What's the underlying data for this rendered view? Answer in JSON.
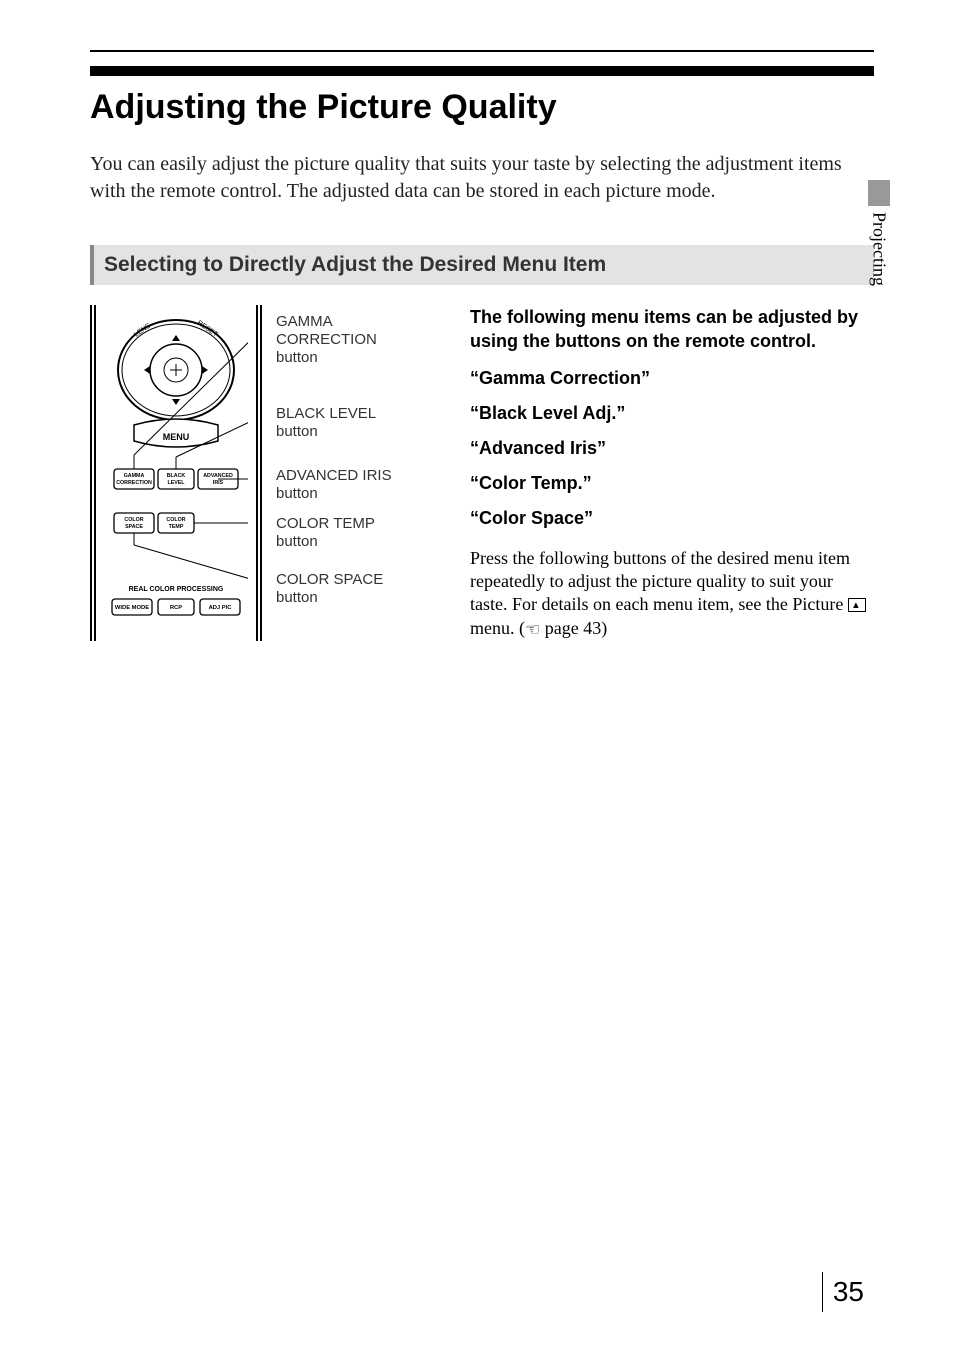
{
  "section_tab": "Projecting",
  "page_number": "35",
  "title": "Adjusting the Picture Quality",
  "intro": "You can easily adjust the picture quality that suits your taste by selecting the adjustment items with the remote control. The adjusted data can be stored in each picture mode.",
  "section_heading": "Selecting to Directly Adjust the Desired Menu Item",
  "diagram": {
    "menu_label": "MENU",
    "buttons": {
      "gamma_correction": "GAMMA\nCORRECTION",
      "black_level": "BLACK\nLEVEL",
      "advanced_iris": "ADVANCED\nIRIS",
      "color_space": "COLOR\nSPACE",
      "color_temp": "COLOR\nTEMP"
    },
    "bottom_label": "REAL COLOR PROCESSING",
    "bottom_buttons": {
      "wide_mode": "WIDE MODE",
      "rcp": "RCP",
      "adj_pic": "ADJ PIC"
    },
    "lens": "LENS",
    "reset": "RESET"
  },
  "callouts": {
    "c1": {
      "l1": "GAMMA",
      "l2": "CORRECTION",
      "l3": "button"
    },
    "c2": {
      "l1": "BLACK LEVEL",
      "l2": "button"
    },
    "c3": {
      "l1": "ADVANCED IRIS",
      "l2": "button"
    },
    "c4": {
      "l1": "COLOR TEMP",
      "l2": "button"
    },
    "c5": {
      "l1": "COLOR SPACE",
      "l2": "button"
    }
  },
  "right": {
    "lead": "The following menu items can be adjusted by using the buttons on the remote control.",
    "items": [
      "“Gamma Correction”",
      "“Black Level Adj.”",
      "“Advanced Iris”",
      "“Color Temp.”",
      "“Color Space”"
    ],
    "detail_before": "Press the following buttons of the desired menu item repeatedly to adjust the picture quality to suit your taste. For details on each menu item, see the Picture",
    "detail_mid": "menu. (",
    "detail_page": " page 43)"
  }
}
